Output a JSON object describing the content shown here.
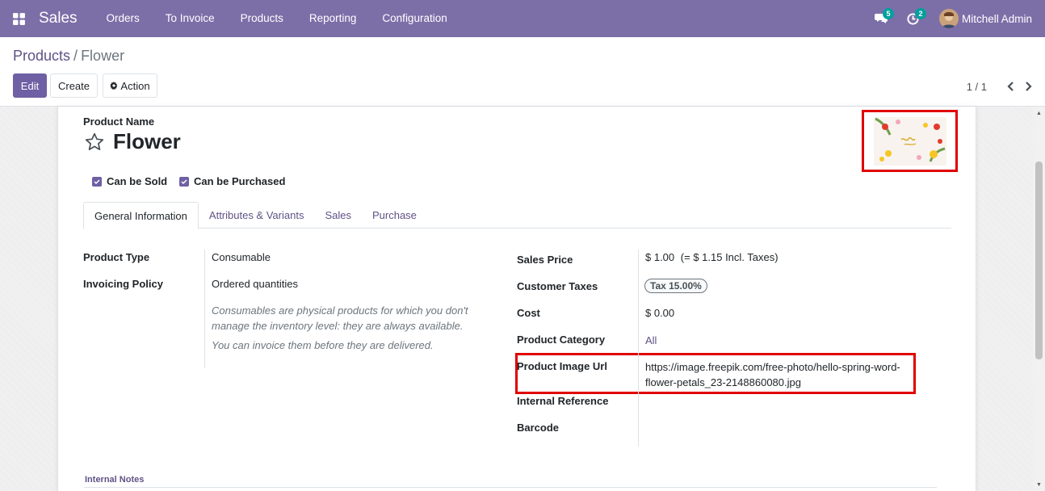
{
  "navbar": {
    "app_name": "Sales",
    "menu": [
      "Orders",
      "To Invoice",
      "Products",
      "Reporting",
      "Configuration"
    ],
    "messages_count": "5",
    "activities_count": "2",
    "user_name": "Mitchell Admin",
    "color": "#7c6fa8"
  },
  "breadcrumb": {
    "parent": "Products",
    "separator": "/",
    "current": "Flower"
  },
  "buttons": {
    "edit": "Edit",
    "create": "Create",
    "action": "Action"
  },
  "pager": {
    "value": "1 / 1"
  },
  "product": {
    "name_label": "Product Name",
    "name": "Flower",
    "can_be_sold": "Can be Sold",
    "can_be_purchased": "Can be Purchased"
  },
  "tabs": [
    "General Information",
    "Attributes & Variants",
    "Sales",
    "Purchase"
  ],
  "left_fields": {
    "product_type_label": "Product Type",
    "product_type": "Consumable",
    "invoicing_policy_label": "Invoicing Policy",
    "invoicing_policy": "Ordered quantities",
    "help_1": "Consumables are physical products for which you don't manage the inventory level: they are always available.",
    "help_2": "You can invoice them before they are delivered."
  },
  "right_fields": {
    "sales_price_label": "Sales Price",
    "sales_price": "$ 1.00",
    "sales_price_incl": "(= $ 1.15 Incl. Taxes)",
    "customer_taxes_label": "Customer Taxes",
    "customer_taxes": "Tax 15.00%",
    "cost_label": "Cost",
    "cost": "$ 0.00",
    "category_label": "Product Category",
    "category": "All",
    "image_url_label": "Product Image Url",
    "image_url": "https://image.freepik.com/free-photo/hello-spring-word-flower-petals_23-2148860080.jpg",
    "internal_ref_label": "Internal Reference",
    "barcode_label": "Barcode"
  },
  "notes": {
    "label": "Internal Notes"
  }
}
